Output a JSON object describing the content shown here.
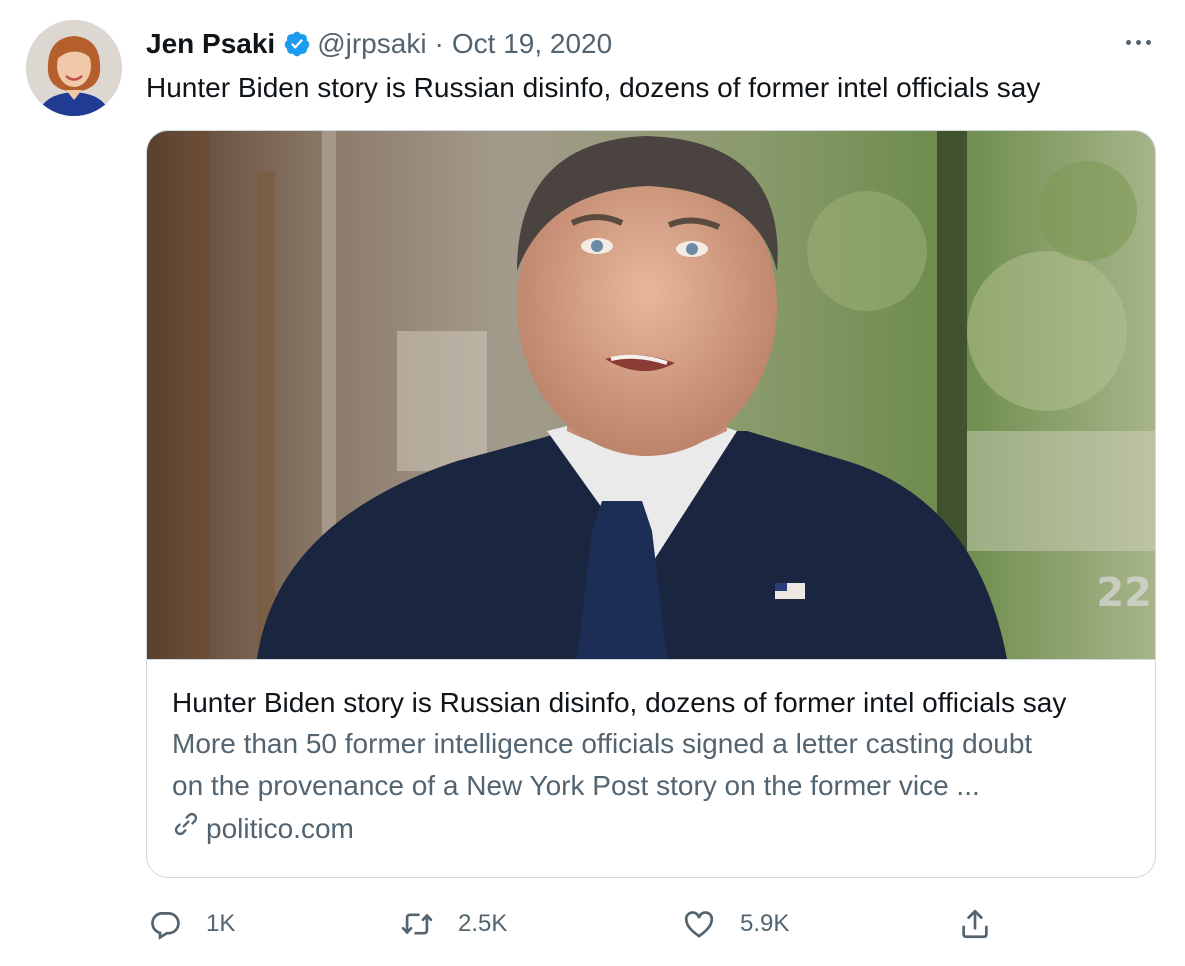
{
  "tweet": {
    "author_name": "Jen Psaki",
    "handle": "@jrpsaki",
    "separator": "·",
    "date": "Oct 19, 2020",
    "text": "Hunter Biden story is Russian disinfo, dozens of former intel officials say"
  },
  "card": {
    "title": "Hunter Biden story is Russian disinfo, dozens of former intel officials say",
    "description_lines": [
      "More than 50 former intelligence officials signed a letter casting doubt",
      "on the provenance of a New York Post story on the former vice ..."
    ],
    "domain": "politico.com",
    "image_watermark": "22"
  },
  "actions": {
    "reply_count": "1K",
    "retweet_count": "2.5K",
    "like_count": "5.9K"
  },
  "icons": {
    "verified": "verified-badge-icon",
    "more": "more-icon",
    "link": "link-icon",
    "reply": "reply-icon",
    "retweet": "retweet-icon",
    "like": "like-icon",
    "share": "share-icon"
  },
  "colors": {
    "text_primary": "#0f1419",
    "text_secondary": "#536471",
    "verified_blue": "#1d9bf0",
    "border": "#cfd9de"
  }
}
